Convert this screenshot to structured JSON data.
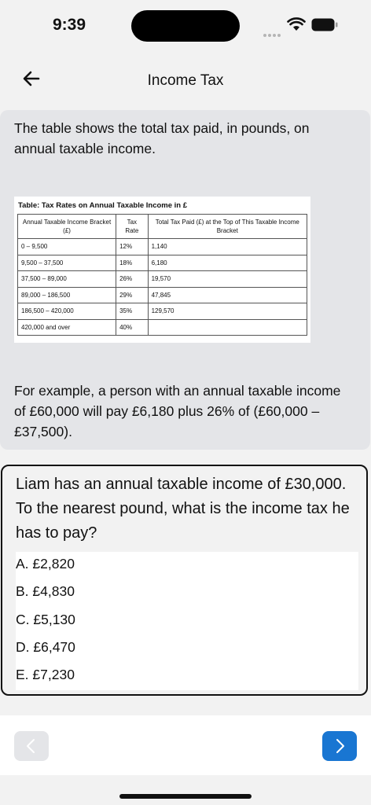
{
  "status_bar": {
    "time": "9:39"
  },
  "nav": {
    "title": "Income Tax"
  },
  "info": {
    "intro": "The table shows the total tax paid, in pounds, on annual taxable income.",
    "table": {
      "caption": "Table: Tax Rates on Annual Taxable Income in £",
      "headers": [
        "Annual Taxable Income Bracket (£)",
        "Tax Rate",
        "Total Tax Paid (£) at the Top of This Taxable Income Bracket"
      ],
      "rows": [
        [
          "0 – 9,500",
          "12%",
          "1,140"
        ],
        [
          "9,500 – 37,500",
          "18%",
          "6,180"
        ],
        [
          "37,500 – 89,000",
          "26%",
          "19,570"
        ],
        [
          "89,000 – 186,500",
          "29%",
          "47,845"
        ],
        [
          "186,500 – 420,000",
          "35%",
          "129,570"
        ],
        [
          "420,000 and over",
          "40%",
          ""
        ]
      ]
    },
    "example": "For example, a person with an annual taxable income of £60,000 will pay £6,180 plus 26% of (£60,000 – £37,500)."
  },
  "question": {
    "text": "Liam has an annual taxable income of £30,000. To the nearest pound, what is the income tax he has to pay?",
    "options": [
      "A.  £2,820",
      "B. £4,830",
      "C.  £5,130",
      "D. £6,470",
      "E. £7,230"
    ]
  },
  "colors": {
    "accent": "#1976d2",
    "card": "#e4e5e8",
    "background": "#f2f2f2"
  },
  "icons": {
    "back": "arrow-left-icon",
    "prev": "chevron-left-icon",
    "next": "chevron-right-icon"
  }
}
